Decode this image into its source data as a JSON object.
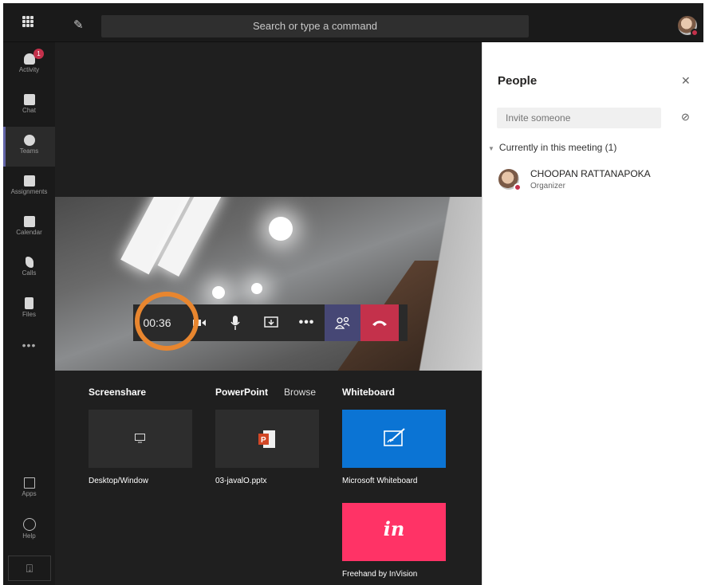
{
  "topbar": {
    "search_placeholder": "Search or type a command"
  },
  "rail": {
    "items": [
      {
        "label": "Activity",
        "badge": "1"
      },
      {
        "label": "Chat"
      },
      {
        "label": "Teams"
      },
      {
        "label": "Assignments"
      },
      {
        "label": "Calendar"
      },
      {
        "label": "Calls"
      },
      {
        "label": "Files"
      }
    ],
    "more": "•••",
    "bottom": [
      {
        "label": "Apps"
      },
      {
        "label": "Help"
      }
    ]
  },
  "call": {
    "timer": "00:36"
  },
  "share_tray": {
    "sections": {
      "screenshare": "Screenshare",
      "powerpoint": "PowerPoint",
      "browse": "Browse",
      "whiteboard": "Whiteboard"
    },
    "tiles": {
      "desktop": "Desktop/Window",
      "pptx": "03-javalO.pptx",
      "ms_whiteboard": "Microsoft Whiteboard",
      "invision": "Freehand by InVision",
      "invision_logo": "in"
    },
    "colors": {
      "whiteboard": "#0b74d4",
      "invision": "#ff3366",
      "powerpoint": "#d24726"
    }
  },
  "people": {
    "title": "People",
    "invite_placeholder": "Invite someone",
    "section_title": "Currently in this meeting (1)",
    "participants": [
      {
        "name": "CHOOPAN RATTANAPOKA",
        "role": "Organizer"
      }
    ]
  },
  "colors": {
    "accent": "#6264a7",
    "hangup": "#c4314b",
    "highlight_ring": "#e8862f"
  }
}
